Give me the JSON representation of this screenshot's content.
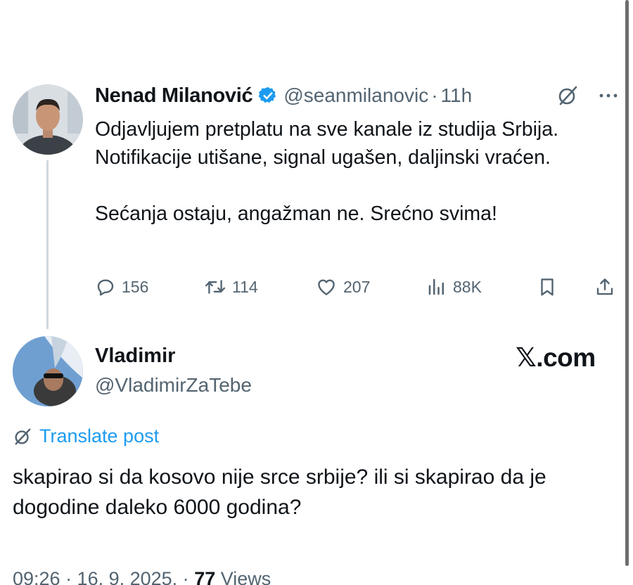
{
  "parent": {
    "author_name": "Nenad Milanović",
    "handle": "@seanmilanovic",
    "dot": "·",
    "time": "11h",
    "paragraph1": "Odjavljujem pretplatu na sve kanale iz studija Srbija. Notifikacije utišane, signal ugašen, daljinski vraćen.",
    "paragraph2": "Sećanja ostaju, angažman ne. Srećno svima!",
    "replies": "156",
    "reposts": "114",
    "likes": "207",
    "views": "88K"
  },
  "reply": {
    "author_name": "Vladimir",
    "handle": "@VladimirZaTebe",
    "translate_label": "Translate post",
    "text": "skapirao si da kosovo nije srce srbije? ili si skapirao da je dogodine daleko 6000 godina?",
    "timestamp": "09:26 · 16. 9. 2025. ·",
    "views_count": "77",
    "views_label": "Views"
  },
  "watermark": "𝕏.com",
  "colors": {
    "text": "#0f1419",
    "secondary": "#536471",
    "accent": "#1d9bf0",
    "thread_line": "#cfd9de"
  },
  "icons": [
    "verified-badge-icon",
    "grok-icon",
    "more-icon",
    "reply-icon",
    "repost-icon",
    "like-icon",
    "views-icon",
    "bookmark-icon",
    "share-icon",
    "translate-icon"
  ]
}
